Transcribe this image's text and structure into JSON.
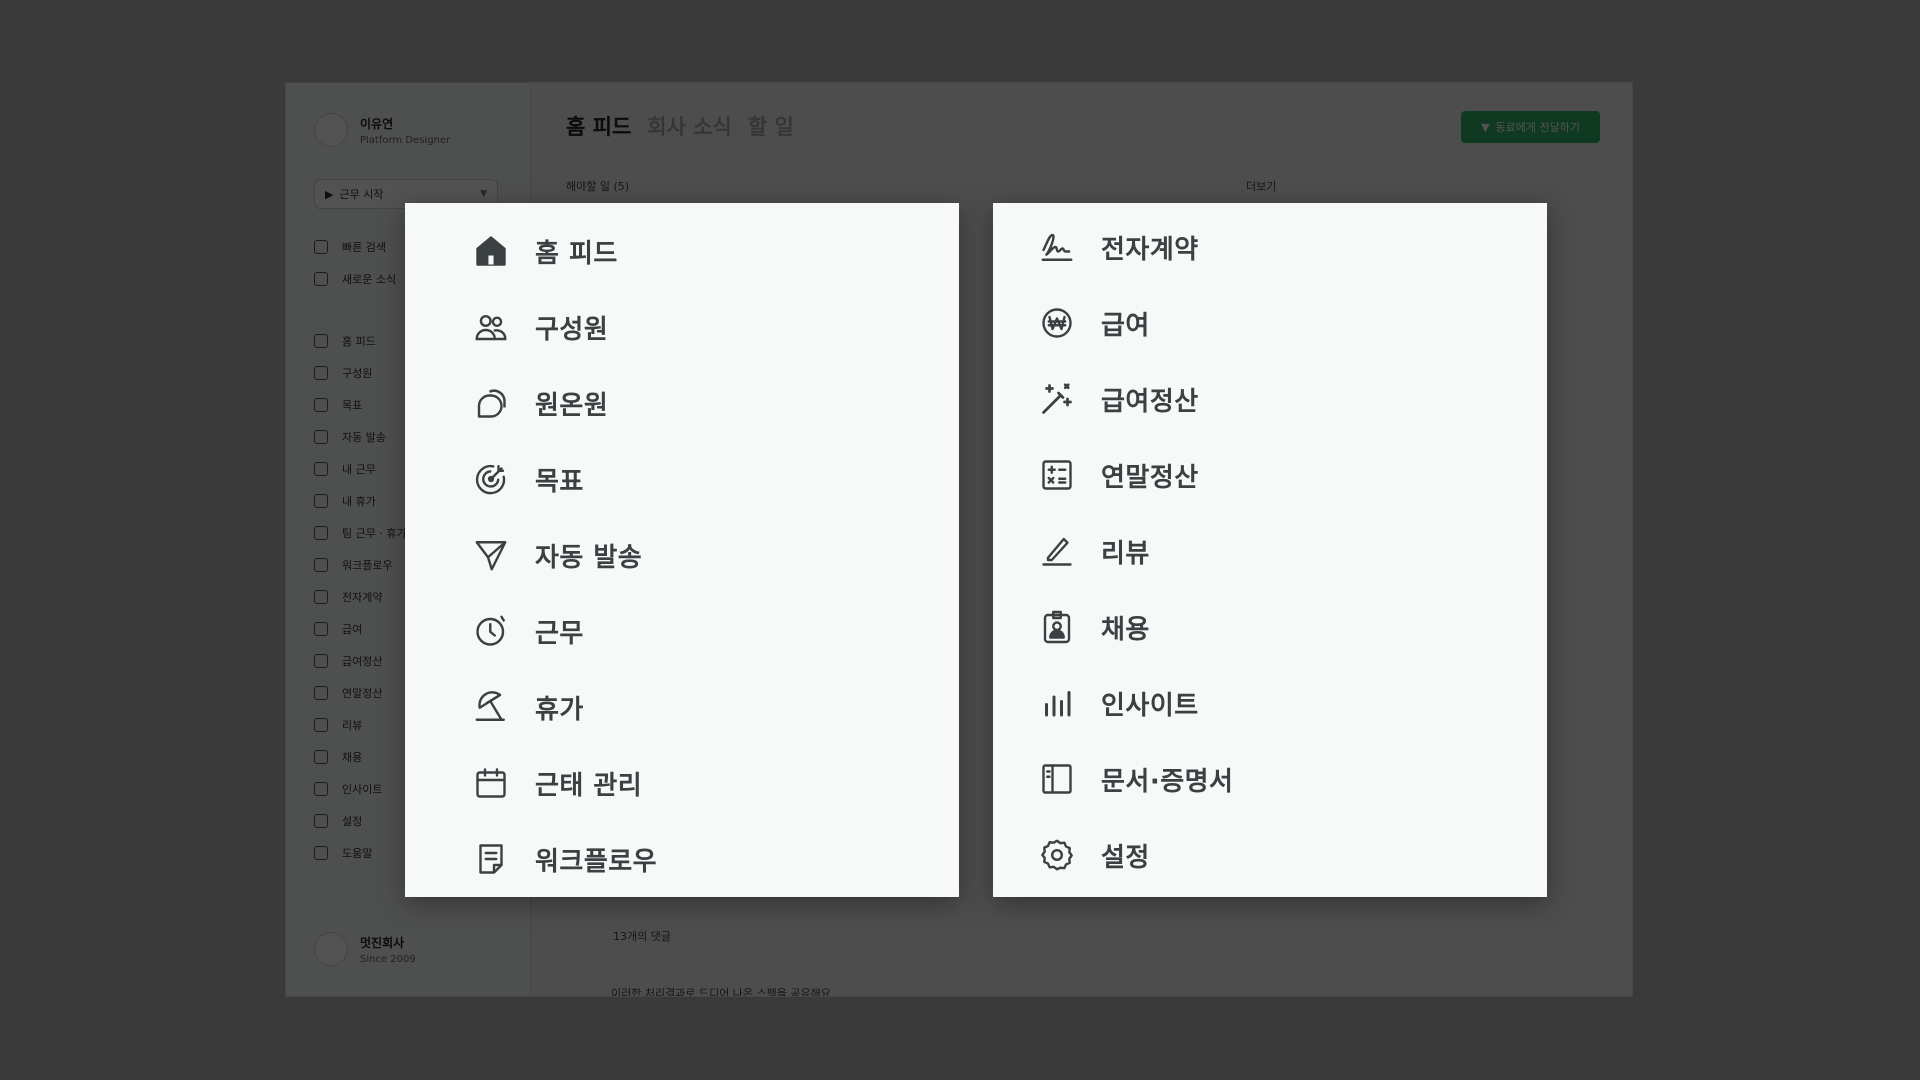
{
  "background_app": {
    "user": {
      "name": "이유연",
      "role": "Platform Designer"
    },
    "work_start_label": "근무 시작",
    "sidebar_top": [
      "빠른 검색",
      "새로운 소식"
    ],
    "sidebar_items": [
      "홈 피드",
      "구성원",
      "목표",
      "자동 발송",
      "내 근무",
      "내 휴가",
      "팀 근무 · 휴가",
      "워크플로우",
      "전자계약",
      "급여",
      "급여정산",
      "연말정산",
      "리뷰",
      "채용",
      "인사이트",
      "설정",
      "도움말"
    ],
    "company": {
      "name": "멋진회사",
      "since": "Since 2009"
    },
    "tabs": [
      "홈 피드",
      "회사 소식",
      "할 일"
    ],
    "share_button": "동료에게 전달하기",
    "todo_header": "해야할 일 (5)",
    "more_label": "더보기",
    "comments_count": "13개의 댓글",
    "post_snippet": "이러한 처리결과로 드디어 나온 스펙을 공유해요"
  },
  "left_menu": [
    {
      "label": "홈 피드",
      "icon": "home-icon"
    },
    {
      "label": "구성원",
      "icon": "people-icon"
    },
    {
      "label": "원온원",
      "icon": "chat-bubbles-icon"
    },
    {
      "label": "목표",
      "icon": "target-icon"
    },
    {
      "label": "자동 발송",
      "icon": "send-icon"
    },
    {
      "label": "근무",
      "icon": "clock-icon"
    },
    {
      "label": "휴가",
      "icon": "beach-umbrella-icon"
    },
    {
      "label": "근태 관리",
      "icon": "calendar-icon"
    },
    {
      "label": "워크플로우",
      "icon": "document-icon"
    }
  ],
  "right_menu": [
    {
      "label": "전자계약",
      "icon": "signature-icon"
    },
    {
      "label": "급여",
      "icon": "won-coin-icon"
    },
    {
      "label": "급여정산",
      "icon": "magic-wand-icon"
    },
    {
      "label": "연말정산",
      "icon": "calculator-icon"
    },
    {
      "label": "리뷰",
      "icon": "pen-icon"
    },
    {
      "label": "채용",
      "icon": "badge-person-icon"
    },
    {
      "label": "인사이트",
      "icon": "bar-chart-icon"
    },
    {
      "label": "문서·증명서",
      "icon": "layout-document-icon"
    },
    {
      "label": "설정",
      "icon": "gear-icon"
    }
  ],
  "colors": {
    "icon": "#3b4142",
    "panel": "#f7f8f8",
    "backdrop": "#3a3a3a",
    "accent": "#2fb466"
  }
}
